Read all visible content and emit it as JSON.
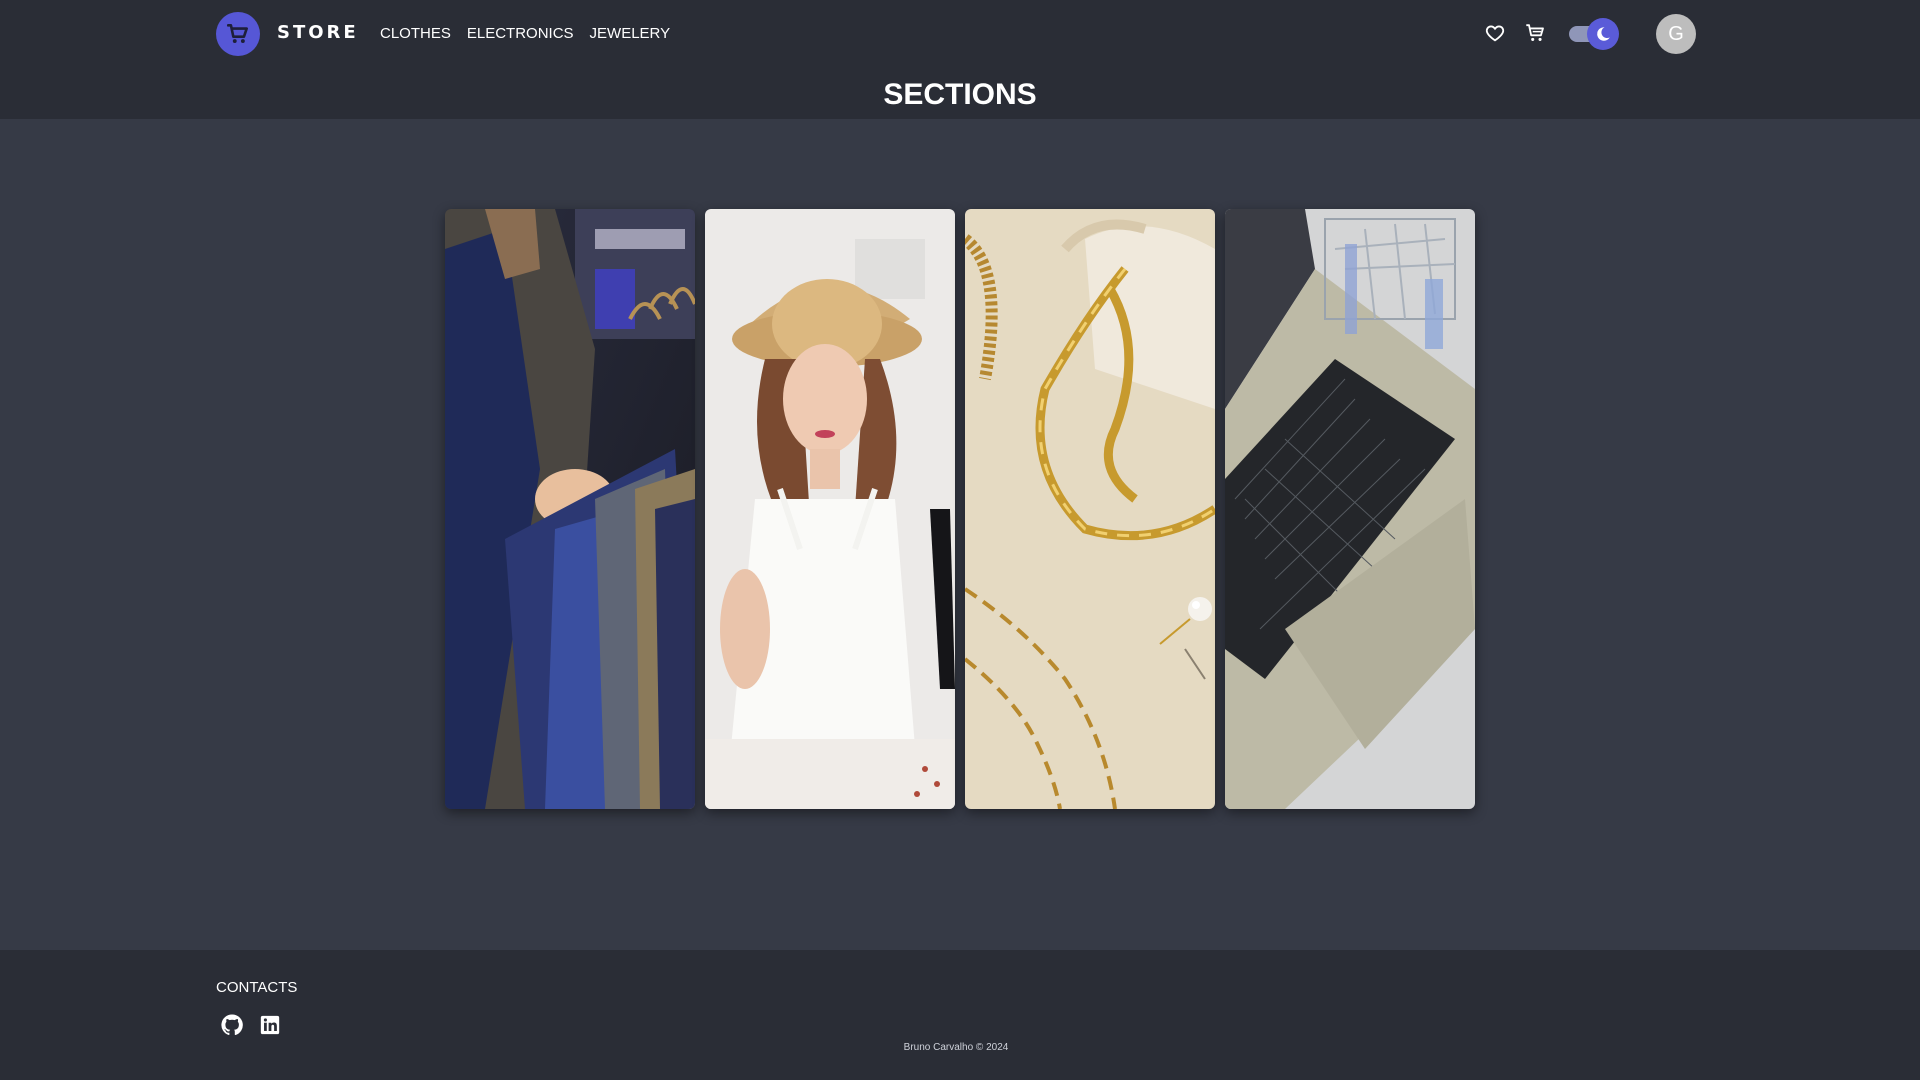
{
  "header": {
    "brand": "STORE",
    "nav": [
      "CLOTHES",
      "ELECTRONICS",
      "JEWELERY"
    ],
    "avatar_initial": "G",
    "theme_mode": "dark",
    "accent_color": "#5657d6"
  },
  "main": {
    "title": "SECTIONS",
    "sections": [
      {
        "id": "clothes-men",
        "image": "man browsing suit jackets on clothing rack"
      },
      {
        "id": "clothes-women",
        "image": "woman in straw hat holding black heels"
      },
      {
        "id": "jewelery",
        "image": "gold chains and pearl earring on linen"
      },
      {
        "id": "electronics",
        "image": "laptop keyboard with mini shopping cart"
      }
    ]
  },
  "footer": {
    "contacts_label": "CONTACTS",
    "social": [
      "github-icon",
      "linkedin-icon"
    ],
    "copyright": "Bruno Carvalho © 2024"
  }
}
